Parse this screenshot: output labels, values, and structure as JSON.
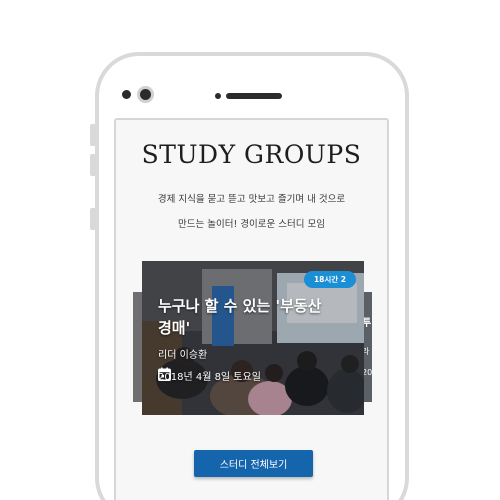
{
  "header": {
    "title": "STUDY GROUPS",
    "description_line1": "경제 지식을 묻고 뜯고 맛보고 즐기며 내 것으로",
    "description_line2": "만드는 놀이터! 경이로운 스터디 모임"
  },
  "card": {
    "badge": "18시간 2",
    "title_line1": "누구나 할 수 있는 '부동산",
    "title_line2": "경매'",
    "leader": "리더 이승환",
    "date": "2018년 4월 8일 토요일",
    "icon": "calendar-icon"
  },
  "next_card_peek": {
    "line1": "투",
    "line2": "라",
    "line3": "20"
  },
  "cta": {
    "label": "스터디 전체보기"
  },
  "colors": {
    "accent": "#1565ad",
    "badge": "#1b8fd6",
    "frame": "#d9d9d9"
  }
}
